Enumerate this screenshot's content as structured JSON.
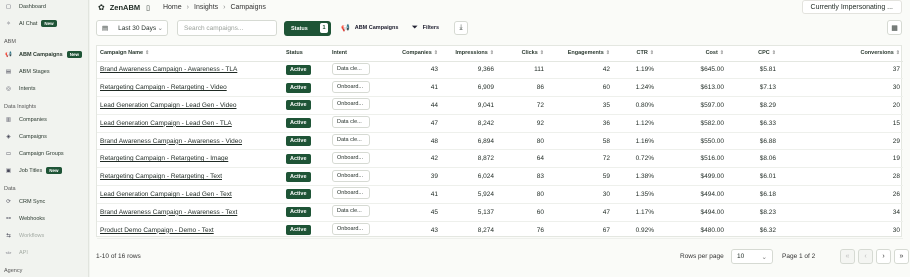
{
  "sidebar": {
    "top_items": [
      {
        "label": "Dashboard",
        "icon": "dashboard-icon"
      },
      {
        "label": "AI Chat",
        "icon": "chat-icon",
        "badge": "New"
      }
    ],
    "sections": [
      {
        "title": "ABM",
        "items": [
          {
            "label": "ABM Campaigns",
            "icon": "megaphone-icon",
            "badge": "New",
            "active": true
          },
          {
            "label": "ABM Stages",
            "icon": "stages-icon"
          },
          {
            "label": "Intents",
            "icon": "intents-icon"
          }
        ]
      },
      {
        "title": "Data Insights",
        "items": [
          {
            "label": "Companies",
            "icon": "building-icon"
          },
          {
            "label": "Campaigns",
            "icon": "campaigns-icon"
          },
          {
            "label": "Campaign Groups",
            "icon": "folder-icon"
          },
          {
            "label": "Job Titles",
            "icon": "briefcase-icon",
            "badge": "New"
          }
        ]
      },
      {
        "title": "Data",
        "items": [
          {
            "label": "CRM Sync",
            "icon": "sync-icon"
          },
          {
            "label": "Webhooks",
            "icon": "webhook-icon"
          },
          {
            "label": "Workflows",
            "icon": "workflow-icon",
            "muted": true
          },
          {
            "label": "API",
            "icon": "api-icon",
            "muted": true
          }
        ]
      },
      {
        "title": "Agency",
        "items": [
          {
            "label": "Agency Home",
            "icon": "home-icon"
          }
        ]
      }
    ]
  },
  "header": {
    "app_name": "ZenABM",
    "breadcrumb": [
      "Home",
      "Insights",
      "Campaigns"
    ],
    "impersonating": "Currently Impersonating ..."
  },
  "toolbar": {
    "date_range": "Last 30 Days",
    "search_placeholder": "Search campaigns...",
    "status_label": "Status",
    "status_count": "1",
    "abm_label": "ABM Campaigns",
    "filters_label": "Filters"
  },
  "table": {
    "columns": [
      "Campaign Name",
      "Status",
      "Intent",
      "Companies",
      "Impressions",
      "Clicks",
      "Engagements",
      "CTR",
      "Cost",
      "CPC",
      "Conversions"
    ],
    "rows": [
      {
        "name": "Brand Awareness Campaign - Awareness - TLA",
        "status": "Active",
        "intent": "Data cle...",
        "companies": "43",
        "impressions": "9,366",
        "clicks": "111",
        "engagements": "42",
        "ctr": "1.19%",
        "cost": "$645.00",
        "cpc": "$5.81",
        "conversions": "37"
      },
      {
        "name": "Retargeting Campaign - Retargeting - Video",
        "status": "Active",
        "intent": "Onboard...",
        "companies": "41",
        "impressions": "6,909",
        "clicks": "86",
        "engagements": "60",
        "ctr": "1.24%",
        "cost": "$613.00",
        "cpc": "$7.13",
        "conversions": "30"
      },
      {
        "name": "Lead Generation Campaign - Lead Gen - Video",
        "status": "Active",
        "intent": "Onboard...",
        "companies": "44",
        "impressions": "9,041",
        "clicks": "72",
        "engagements": "35",
        "ctr": "0.80%",
        "cost": "$597.00",
        "cpc": "$8.29",
        "conversions": "20"
      },
      {
        "name": "Lead Generation Campaign - Lead Gen - TLA",
        "status": "Active",
        "intent": "Data cle...",
        "companies": "47",
        "impressions": "8,242",
        "clicks": "92",
        "engagements": "36",
        "ctr": "1.12%",
        "cost": "$582.00",
        "cpc": "$6.33",
        "conversions": "15"
      },
      {
        "name": "Brand Awareness Campaign - Awareness - Video",
        "status": "Active",
        "intent": "Data cle...",
        "companies": "48",
        "impressions": "6,894",
        "clicks": "80",
        "engagements": "58",
        "ctr": "1.16%",
        "cost": "$550.00",
        "cpc": "$6.88",
        "conversions": "29"
      },
      {
        "name": "Retargeting Campaign - Retargeting - Image",
        "status": "Active",
        "intent": "Onboard...",
        "companies": "42",
        "impressions": "8,872",
        "clicks": "64",
        "engagements": "72",
        "ctr": "0.72%",
        "cost": "$516.00",
        "cpc": "$8.06",
        "conversions": "19"
      },
      {
        "name": "Retargeting Campaign - Retargeting - Text",
        "status": "Active",
        "intent": "Onboard...",
        "companies": "39",
        "impressions": "6,024",
        "clicks": "83",
        "engagements": "59",
        "ctr": "1.38%",
        "cost": "$499.00",
        "cpc": "$6.01",
        "conversions": "28"
      },
      {
        "name": "Lead Generation Campaign - Lead Gen - Text",
        "status": "Active",
        "intent": "Onboard...",
        "companies": "41",
        "impressions": "5,924",
        "clicks": "80",
        "engagements": "30",
        "ctr": "1.35%",
        "cost": "$494.00",
        "cpc": "$6.18",
        "conversions": "26"
      },
      {
        "name": "Brand Awareness Campaign - Awareness - Text",
        "status": "Active",
        "intent": "Data cle...",
        "companies": "45",
        "impressions": "5,137",
        "clicks": "60",
        "engagements": "47",
        "ctr": "1.17%",
        "cost": "$494.00",
        "cpc": "$8.23",
        "conversions": "34"
      },
      {
        "name": "Product Demo Campaign - Demo - Text",
        "status": "Active",
        "intent": "Onboard...",
        "companies": "43",
        "impressions": "8,274",
        "clicks": "76",
        "engagements": "67",
        "ctr": "0.92%",
        "cost": "$480.00",
        "cpc": "$6.32",
        "conversions": "30"
      }
    ]
  },
  "footer": {
    "rows_info": "1-10 of 16 rows",
    "rows_per_page_label": "Rows per page",
    "rows_per_page_value": "10",
    "page_info": "Page 1 of 2"
  }
}
